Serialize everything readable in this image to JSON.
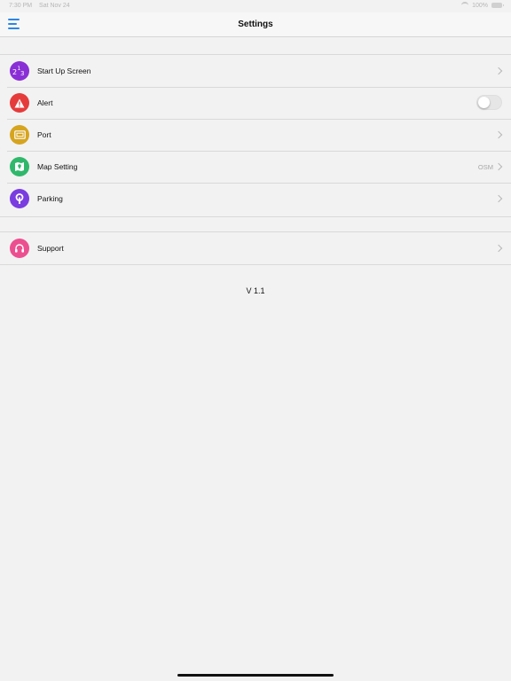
{
  "status_bar": {
    "time": "7:30 PM",
    "date": "Sat Nov 24",
    "battery": "100%"
  },
  "nav": {
    "title": "Settings"
  },
  "settings": {
    "items": [
      {
        "label": "Start Up Screen",
        "icon": "number-123-icon",
        "color": "#8a2fd6",
        "accessory": "chevron"
      },
      {
        "label": "Alert",
        "icon": "warning-icon",
        "color": "#e53b3b",
        "accessory": "toggle",
        "enabled": false
      },
      {
        "label": "Port",
        "icon": "port-icon",
        "color": "#d6a41f",
        "accessory": "chevron"
      },
      {
        "label": "Map Setting",
        "icon": "map-icon",
        "color": "#2fb86b",
        "accessory": "chevron",
        "value": "OSM"
      },
      {
        "label": "Parking",
        "icon": "parking-icon",
        "color": "#7a3de0",
        "accessory": "chevron"
      }
    ]
  },
  "support": {
    "items": [
      {
        "label": "Support",
        "icon": "headphones-icon",
        "color": "#ec4f8f",
        "accessory": "chevron"
      }
    ]
  },
  "version": "V 1.1",
  "colors": {
    "accent": "#2a86e8",
    "background": "#f2f2f2"
  }
}
